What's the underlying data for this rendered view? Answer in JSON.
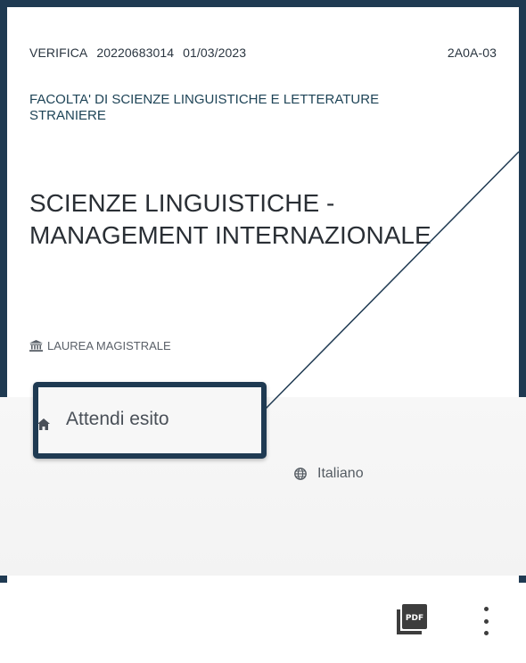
{
  "card": {
    "meta": {
      "type": "VERIFICA",
      "number": "20220683014",
      "date": "01/03/2023",
      "code": "2A0A-03"
    },
    "faculty": "FACOLTA' DI SCIENZE LINGUISTICHE E LETTERATURE STRANIERE",
    "course_title": "SCIENZE LINGUISTICHE - MANAGEMENT INTERNAZIONALE",
    "degree": "LAUREA MAGISTRALE",
    "status": "Attendi esito",
    "language": "Italiano"
  },
  "icons": {
    "degree": "institution-icon",
    "status": "home-icon",
    "language": "globe-icon",
    "pdf": "pdf-file-icon",
    "menu": "more-vertical-icon"
  },
  "colors": {
    "frame": "#1f3a52",
    "band": "#f5f5f5",
    "text": "#2a2f35"
  }
}
